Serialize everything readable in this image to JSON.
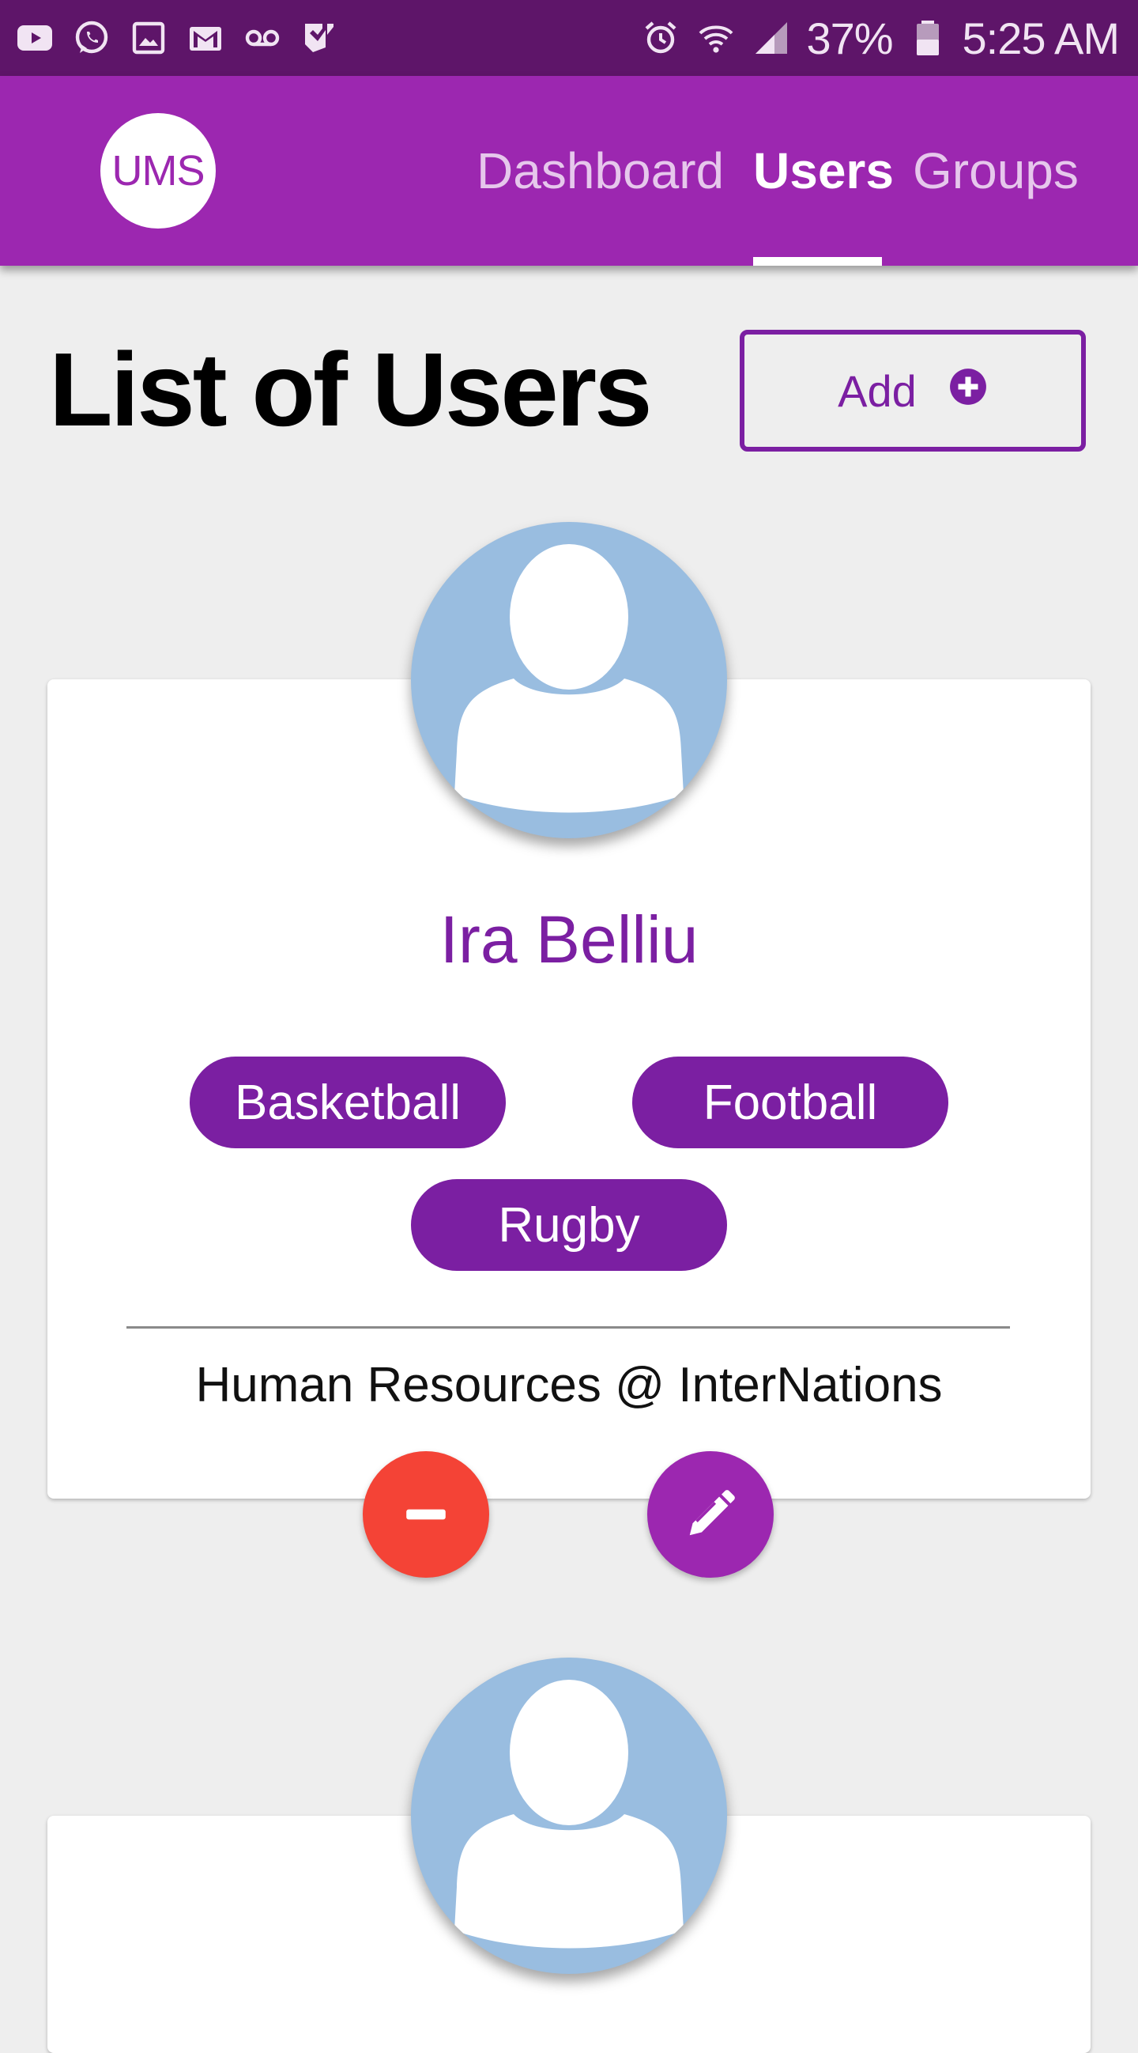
{
  "status_bar": {
    "battery": "37%",
    "time": "5:25 AM",
    "left_icons": [
      "youtube-icon",
      "whatsapp-icon",
      "gallery-icon",
      "gmail-icon",
      "voicemail-icon",
      "task-check-icon"
    ],
    "right_icons": [
      "alarm-icon",
      "wifi-icon",
      "signal-icon",
      "battery-icon"
    ]
  },
  "app_bar": {
    "logo": "UMS",
    "nav": [
      {
        "label": "Dashboard",
        "active": false
      },
      {
        "label": "Users",
        "active": true
      },
      {
        "label": "Groups",
        "active": false
      }
    ]
  },
  "page": {
    "title": "List of Users",
    "add_label": "Add"
  },
  "users": [
    {
      "name": "Ira Belliu",
      "tags": [
        "Basketball",
        "Football",
        "Rugby"
      ],
      "company": "Human Resources @ InterNations"
    },
    {
      "name": "",
      "tags": [],
      "company": ""
    }
  ],
  "colors": {
    "status_bar": "#5e1569",
    "app_bar": "#9c27b0",
    "accent": "#7b1fa2",
    "delete": "#f44336",
    "avatar": "#99bde0",
    "background": "#eeeeee"
  }
}
